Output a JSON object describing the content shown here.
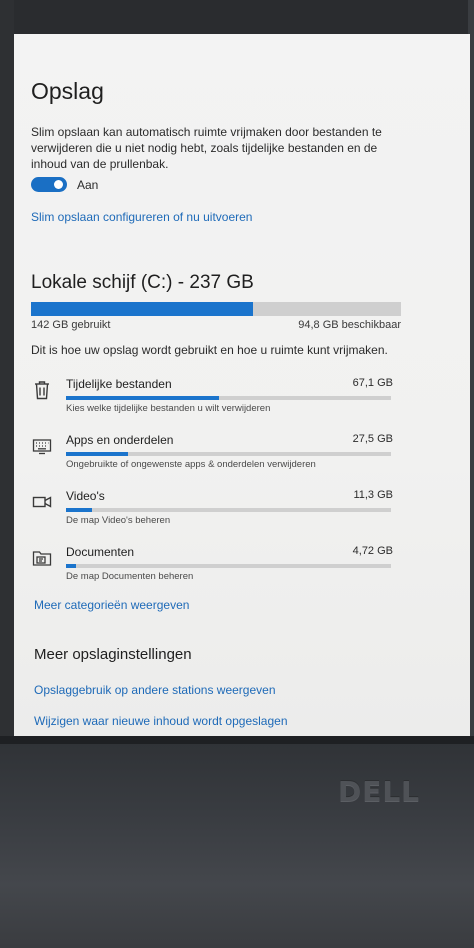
{
  "header": {
    "title": "Opslag"
  },
  "smart_storage": {
    "description": "Slim opslaan kan automatisch ruimte vrijmaken door bestanden te verwijderen die u niet nodig hebt, zoals tijdelijke bestanden en de inhoud van de prullenbak.",
    "toggle_state": "on",
    "toggle_label": "Aan",
    "configure_link": "Slim opslaan configureren of nu uitvoeren"
  },
  "drive": {
    "title": "Lokale schijf (C:) - 237 GB",
    "used_label": "142 GB gebruikt",
    "free_label": "94,8 GB beschikbaar",
    "used_fraction": 0.6,
    "intro": "Dit is hoe uw opslag wordt gebruikt en hoe u ruimte kunt vrijmaken."
  },
  "categories": [
    {
      "name": "Tijdelijke bestanden",
      "size": "67,1 GB",
      "fraction": 0.47,
      "description": "Kies welke tijdelijke bestanden u wilt verwijderen",
      "icon": "trash-icon"
    },
    {
      "name": "Apps en onderdelen",
      "size": "27,5 GB",
      "fraction": 0.19,
      "description": "Ongebruikte of ongewenste apps & onderdelen verwijderen",
      "icon": "keyboard-icon"
    },
    {
      "name": "Video's",
      "size": "11,3 GB",
      "fraction": 0.08,
      "description": "De map Video's beheren",
      "icon": "video-camera-icon"
    },
    {
      "name": "Documenten",
      "size": "4,72 GB",
      "fraction": 0.03,
      "description": "De map Documenten beheren",
      "icon": "documents-folder-icon"
    }
  ],
  "more_categories_link": "Meer categorieën weergeven",
  "more_settings": {
    "title": "Meer opslaginstellingen",
    "links": [
      "Opslaggebruik op andere stations weergeven",
      "Wijzigen waar nieuwe inhoud wordt opgeslagen"
    ]
  },
  "bezel": {
    "brand_logo": "DELL"
  },
  "colors": {
    "accent": "#1b74cc",
    "link": "#1e6ab8",
    "bar_track": "#cfcfcf"
  }
}
